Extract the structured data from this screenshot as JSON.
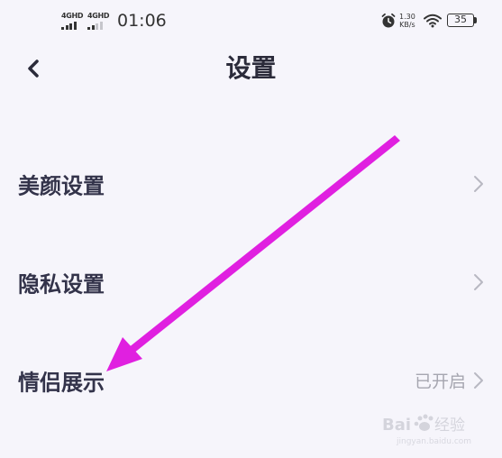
{
  "status_bar": {
    "signal_1_label": "4GHD",
    "signal_2_label": "4GHD",
    "time": "01:06",
    "net_speed_value": "1.30",
    "net_speed_unit": "KB/s",
    "battery_level": "35",
    "icons": [
      "alarm-icon",
      "wifi-icon",
      "battery-icon"
    ]
  },
  "header": {
    "title": "设置",
    "back_icon": "chevron-left-icon"
  },
  "settings": {
    "items": [
      {
        "label": "美颜设置",
        "value": ""
      },
      {
        "label": "隐私设置",
        "value": ""
      },
      {
        "label": "情侣展示",
        "value": "已开启"
      }
    ]
  },
  "annotation": {
    "color": "#e020e0"
  },
  "colors": {
    "background": "#f6f5fb",
    "text_primary": "#33334a",
    "text_secondary": "#a6a6b0"
  }
}
